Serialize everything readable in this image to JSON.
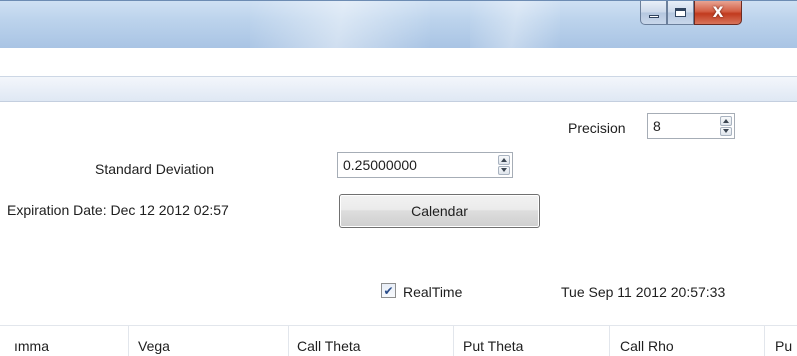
{
  "window": {
    "caption_buttons": {
      "minimize_icon": "minimize-icon",
      "maximize_icon": "maximize-icon",
      "close_icon": "close-icon",
      "close_glyph": "X"
    }
  },
  "form": {
    "precision_label": "Precision",
    "precision_value": "8",
    "std_dev_label": "Standard Deviation",
    "std_dev_value": "0.25000000",
    "expiration_label": "Expiration Date: Dec 12 2012 02:57",
    "calendar_button": "Calendar",
    "realtime_label": "RealTime",
    "realtime_checked": true,
    "timestamp": "Tue Sep 11 2012 20:57:33"
  },
  "table": {
    "columns": [
      "ımma",
      "Vega",
      "Call Theta",
      "Put Theta",
      "Call Rho",
      "Pu"
    ]
  },
  "colors": {
    "titlebar": "#bcd3ec",
    "close_button": "#c13a1e",
    "checkmark": "#2a4d8a"
  }
}
